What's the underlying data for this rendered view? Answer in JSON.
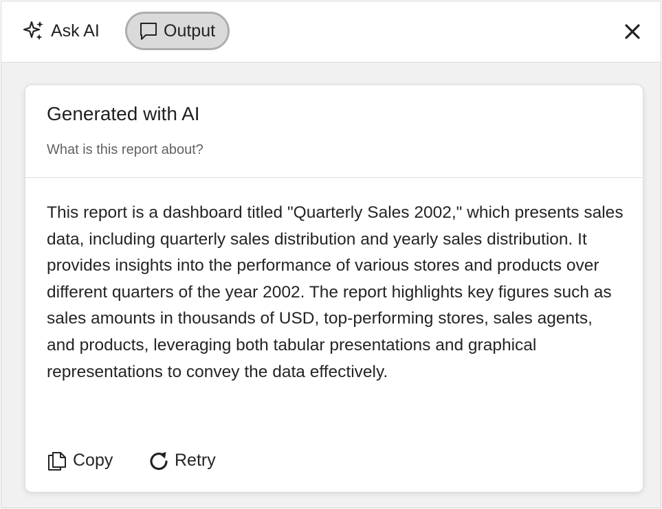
{
  "header": {
    "tabs": [
      {
        "label": "Ask AI",
        "icon": "sparkle-icon",
        "active": false
      },
      {
        "label": "Output",
        "icon": "chat-bubble-icon",
        "active": true
      }
    ],
    "close_icon": "close-icon"
  },
  "card": {
    "title": "Generated with AI",
    "question": "What is this report about?",
    "answer": "This report is a dashboard titled \"Quarterly Sales 2002,\" which presents sales data, including quarterly sales distribution and yearly sales distribution. It provides insights into the performance of various stores and products over different quarters of the year 2002. The report highlights key figures such as sales amounts in thousands of USD, top-performing stores, sales agents, and products, leveraging both tabular presentations and graphical representations to convey the data effectively.",
    "actions": [
      {
        "label": "Copy",
        "icon": "copy-icon"
      },
      {
        "label": "Retry",
        "icon": "retry-icon"
      }
    ]
  },
  "colors": {
    "active_tab_bg": "#dadada",
    "active_tab_border": "#adadad",
    "panel_bg": "#f1f1f1",
    "card_bg": "#ffffff"
  }
}
